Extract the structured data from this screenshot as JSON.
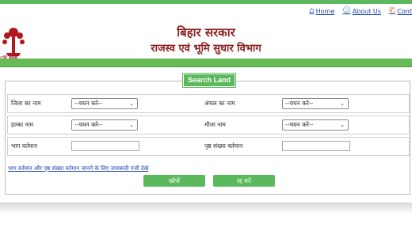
{
  "colors": {
    "accent_green": "#5cb85c",
    "title_maroon": "#8a1f1f",
    "link_blue": "#1a3fb0"
  },
  "top_links": [
    {
      "label": "Home",
      "icon": "home-icon"
    },
    {
      "label": "About Us",
      "icon": "people-icon"
    },
    {
      "label": "Cont",
      "icon": "phone-icon"
    }
  ],
  "header": {
    "logo_text": "ार भूमि",
    "title": "बिहार सरकार",
    "subtitle": "राजस्व एवं भूमि सुधार विभाग"
  },
  "search": {
    "legend": "Search Land",
    "district_label": "जिला का नाम",
    "district_value": "--चयन करे--",
    "circle_label": "अंचल का नाम",
    "circle_value": "--चयन करे--",
    "halka_label": "हल्का नाम",
    "halka_value": "--चयन करे--",
    "mauja_label": "मौजा नाम",
    "mauja_value": "--चयन करे--",
    "bhag_label": "भाग वर्तमान",
    "bhag_value": "",
    "page_label": "पृष्ठ संख्या वर्तमान",
    "page_value": "",
    "jamabandi_link": "भाग वर्तमान और पृष्ठ संख्या वर्तमान जानने के लिए जमाबन्दी पंजी देखे",
    "search_button": "खोजें",
    "cancel_button": "रद्द करें"
  }
}
